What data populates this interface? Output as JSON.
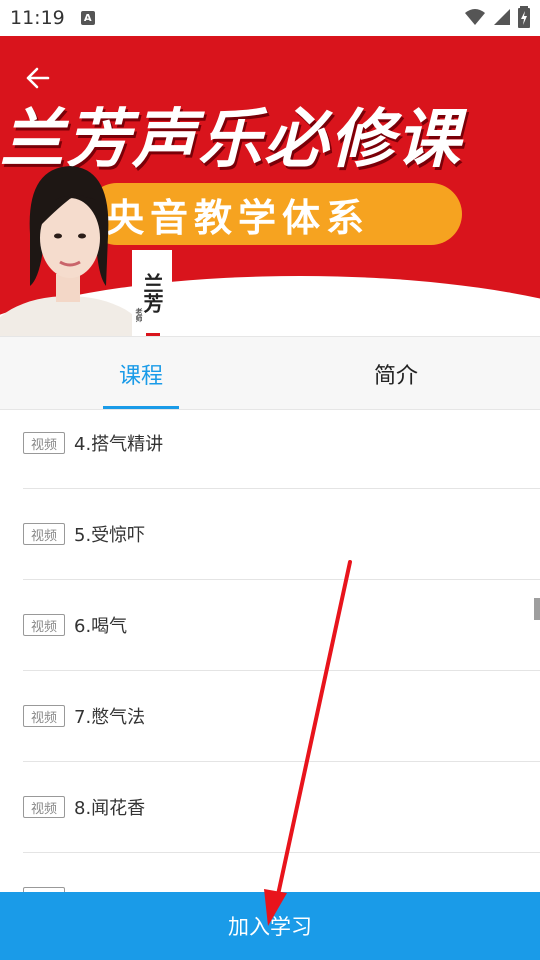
{
  "status_bar": {
    "time": "11:19",
    "notification_icon": "A"
  },
  "banner": {
    "title": "兰芳声乐必修课",
    "subtitle": "央音教学体系",
    "teacher_name": "兰芳",
    "teacher_label": "老师"
  },
  "tabs": [
    {
      "label": "课程",
      "active": true
    },
    {
      "label": "简介",
      "active": false
    }
  ],
  "lessons": [
    {
      "badge": "视频",
      "title": "4.搭气精讲"
    },
    {
      "badge": "视频",
      "title": "5.受惊吓"
    },
    {
      "badge": "视频",
      "title": "6.喝气"
    },
    {
      "badge": "视频",
      "title": "7.憋气法"
    },
    {
      "badge": "视频",
      "title": "8.闻花香"
    },
    {
      "badge": "视频",
      "title": ""
    }
  ],
  "join_button": {
    "label": "加入学习"
  },
  "colors": {
    "accent": "#1a9be8",
    "banner_red": "#d9141c",
    "pill_orange": "#f6a320"
  }
}
